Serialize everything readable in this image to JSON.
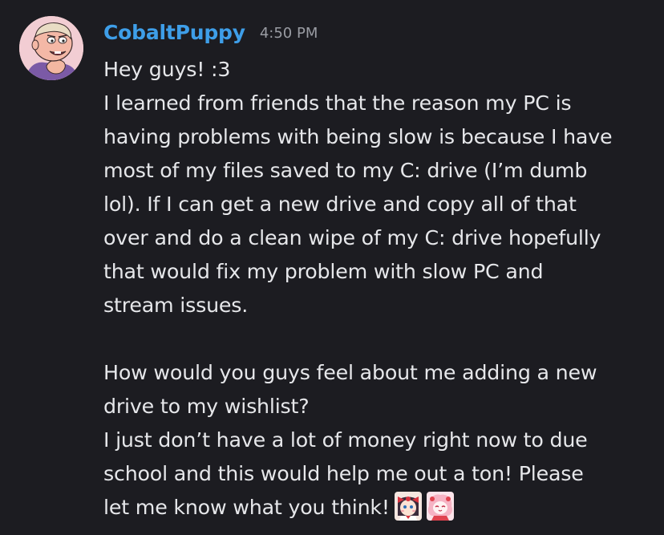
{
  "message": {
    "author": "CobaltPuppy",
    "timestamp": "4:50 PM",
    "avatar_icon": "cartoon-boy-avatar",
    "lines": [
      "Hey guys! :3",
      "I learned from friends that the reason my PC is",
      "having problems with being slow is because I have",
      "most of my files saved to my C: drive (I’m dumb",
      "lol). If I can get a new drive and copy all of that",
      "over and do a clean wipe of my C: drive hopefully",
      "that would fix my problem with slow PC and",
      "stream issues.",
      "",
      "How would you guys feel about me adding a new",
      "drive to my wishlist?",
      "I just don’t have a lot of money right now to due",
      "school and this would help me out a ton! Please",
      "let me know what you think!"
    ],
    "emojis": [
      "custom-emote-girl-red-bow",
      "custom-emote-pink-character"
    ]
  },
  "colors": {
    "background": "#1c1c21",
    "username": "#3e9ee8",
    "timestamp": "#9a9ca3",
    "text": "#e6e7ea"
  }
}
